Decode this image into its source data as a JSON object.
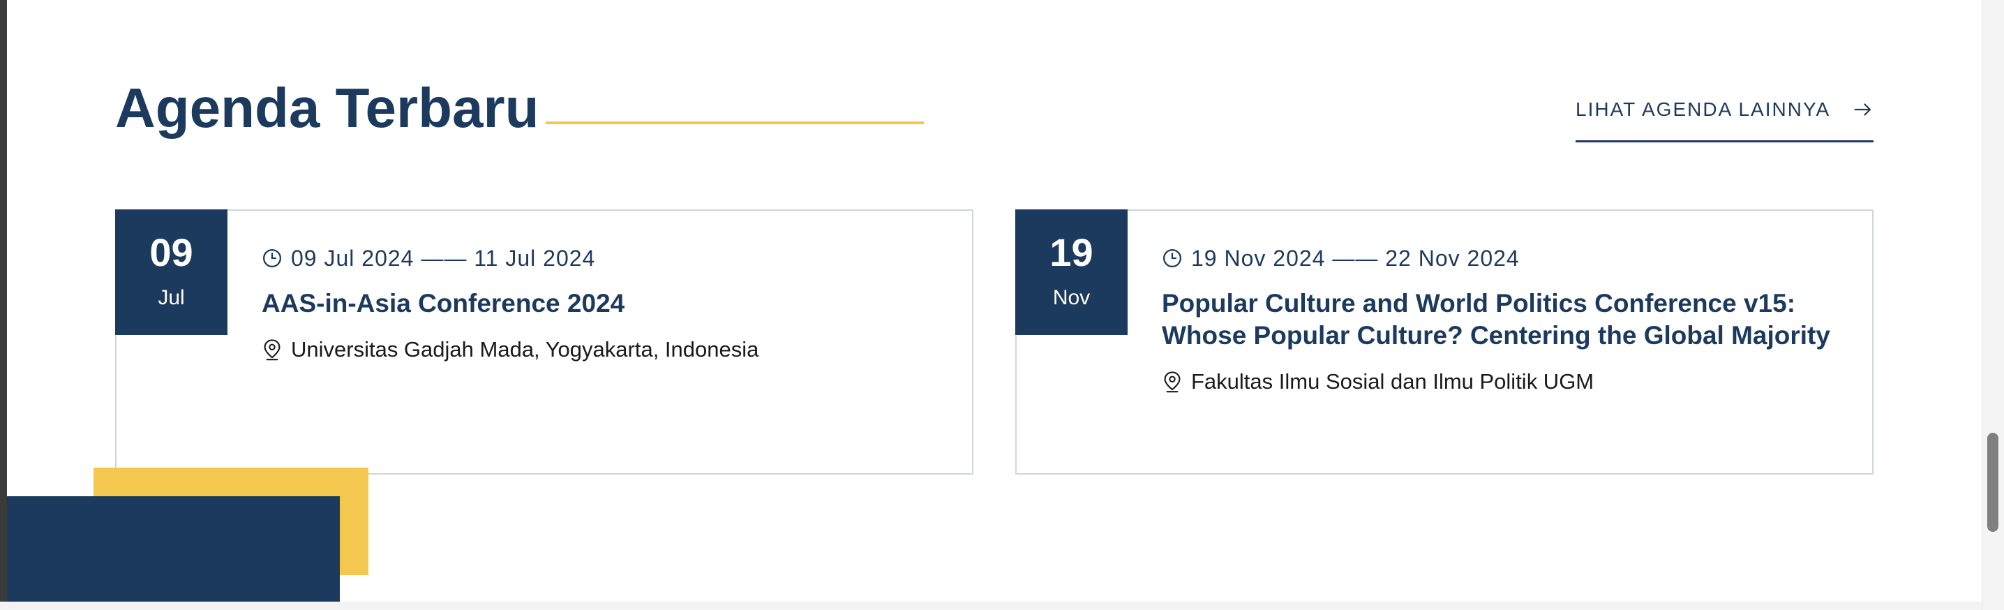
{
  "section": {
    "title": "Agenda Terbaru",
    "see_more_label": "LIHAT AGENDA LAINNYA"
  },
  "events": [
    {
      "day": "09",
      "month": "Jul",
      "date_range": "09 Jul 2024 —— 11 Jul 2024",
      "title": "AAS-in-Asia Conference 2024",
      "location": "Universitas Gadjah Mada, Yogyakarta, Indonesia",
      "icons": [
        "clock-icon",
        "map-pin-icon"
      ]
    },
    {
      "day": "19",
      "month": "Nov",
      "date_range": "19 Nov 2024 —— 22 Nov 2024",
      "title": "Popular Culture and World Politics Conference v15: Whose Popular Culture? Centering the Global Majority",
      "location": "Fakultas Ilmu Sosial dan Ilmu Politik UGM",
      "icons": [
        "clock-icon",
        "map-pin-icon"
      ]
    }
  ],
  "colors": {
    "navy": "#1c3a5e",
    "accent_yellow": "#f4c84e",
    "card_border": "#d1d6dd"
  }
}
